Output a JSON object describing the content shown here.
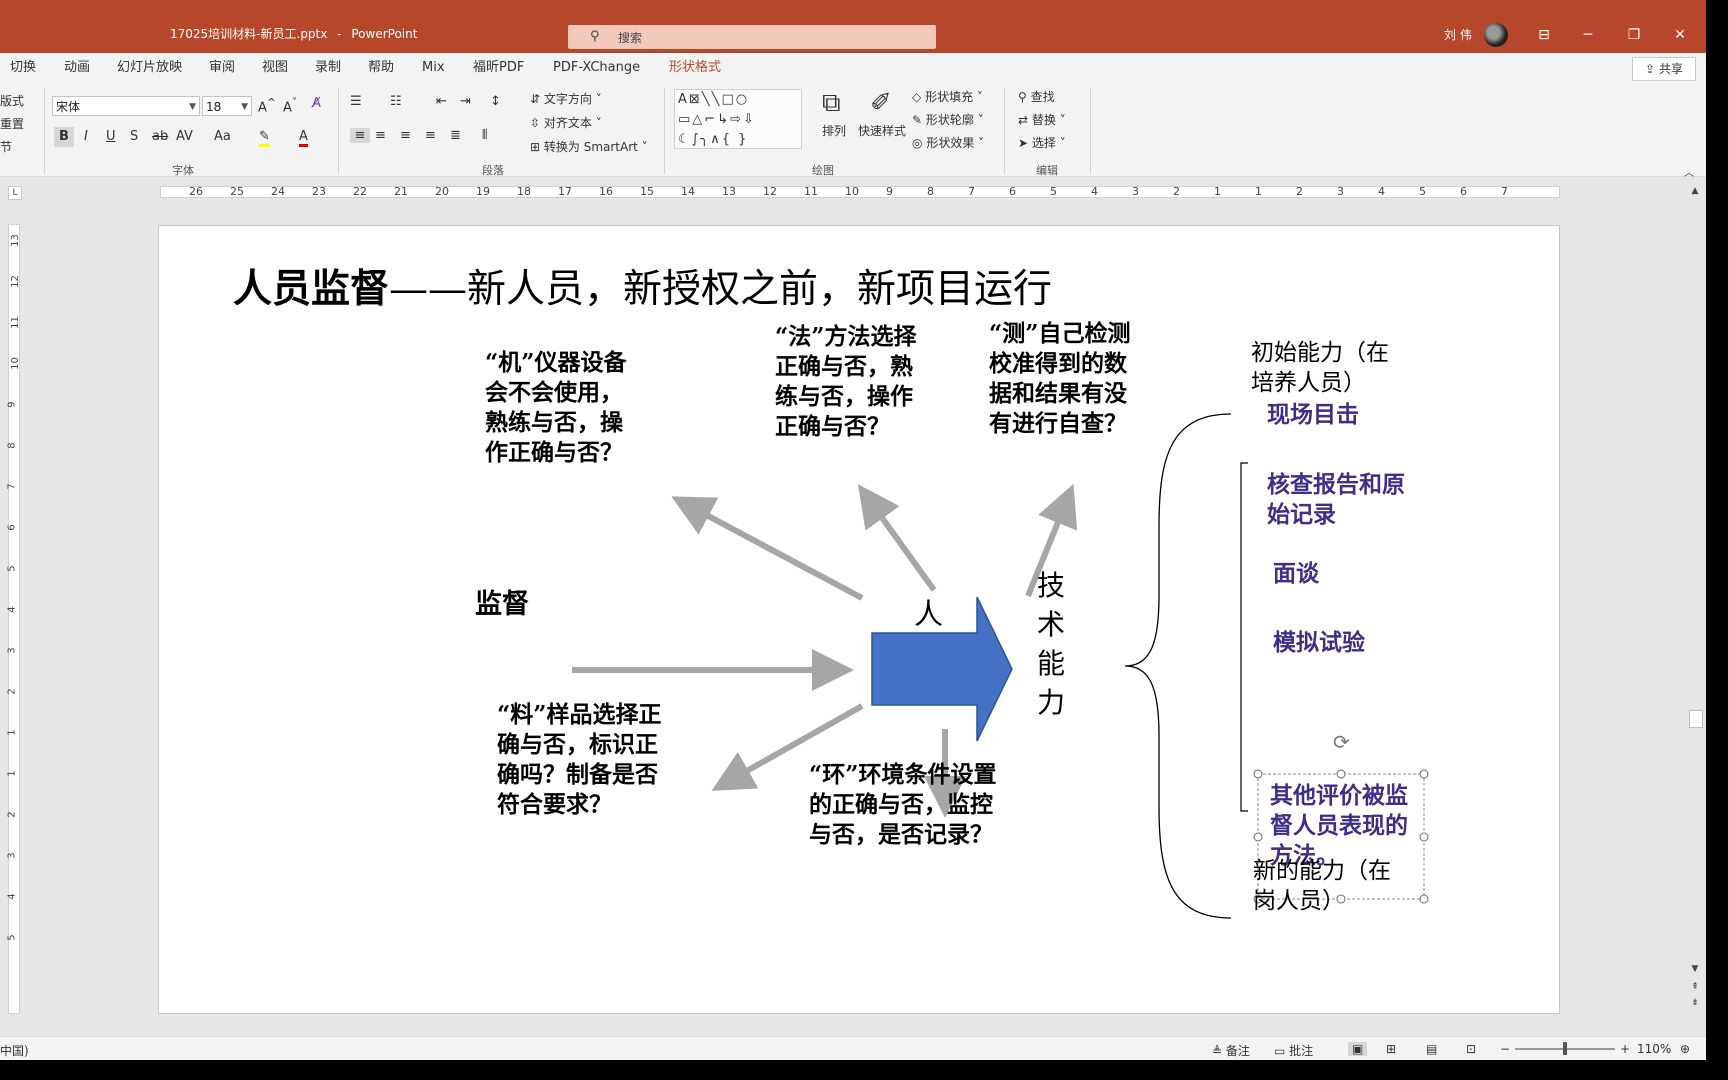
{
  "window": {
    "file_title": "17025培训材料-新员工.pptx",
    "separator": "-",
    "app_name": "PowerPoint",
    "search_placeholder": "搜索",
    "user_name": "刘 伟"
  },
  "tabs": [
    "切换",
    "动画",
    "幻灯片放映",
    "审阅",
    "视图",
    "录制",
    "帮助",
    "Mix",
    "福昕PDF",
    "PDF-XChange",
    "形状格式"
  ],
  "share_label": "共享",
  "ribbon": {
    "left_partial": [
      "版式",
      "重置",
      "节"
    ],
    "font_name": "宋体",
    "font_size": "18",
    "font_group_label": "字体",
    "paragraph_group_label": "段落",
    "drawing_group_label": "绘图",
    "editing_group_label": "编辑",
    "text_direction": "文字方向",
    "align_text": "对齐文本",
    "convert_smartart": "转换为 SmartArt",
    "arrange": "排列",
    "quick_styles": "快速样式",
    "shape_fill": "形状填充",
    "shape_outline": "形状轮廓",
    "shape_effects": "形状效果",
    "find": "查找",
    "replace": "替换",
    "select": "选择"
  },
  "ruler_numbers": [
    "26",
    "25",
    "24",
    "23",
    "22",
    "21",
    "20",
    "19",
    "18",
    "17",
    "16",
    "15",
    "14",
    "13",
    "12",
    "11",
    "10",
    "9",
    "8",
    "7",
    "6",
    "5",
    "4",
    "3",
    "2",
    "1",
    "1",
    "2",
    "3",
    "4",
    "5",
    "6",
    "7"
  ],
  "vruler_numbers": [
    "13",
    "12",
    "11",
    "10",
    "9",
    "8",
    "7",
    "6",
    "5",
    "4",
    "3",
    "2",
    "1",
    "1",
    "2",
    "3",
    "4",
    "5"
  ],
  "slide": {
    "title_bold": "人员监督",
    "title_rest": "——新人员，新授权之前，新项目运行",
    "ji": "“机”仪器设备会不会使用，熟练与否，操作正确与否？",
    "fa": "“法”方法选择正确与否，熟练与否，操作正确与否？",
    "ce": "“测”自己检测校准得到的数据和结果有没有进行自查？",
    "liao": "“料”样品选择正确与否，标识正确吗？制备是否符合要求？",
    "huan": "“环”环境条件设置的正确与否，监控与否，是否记录？",
    "jiandu": "监督",
    "ren": "人",
    "jishu": "技术能力",
    "initial": "初始能力（在培养人员）",
    "methods": [
      "现场目击",
      "核查报告和原始记录",
      "面谈",
      "模拟试验",
      "其他评价被监督人员表现的方法。"
    ],
    "new_ability": "新的能力（在岗人员）"
  },
  "statusbar": {
    "lang": "中国)",
    "notes": "备注",
    "comments": "批注",
    "zoom": "110%"
  },
  "colors": {
    "titlebar": "#b7472a",
    "arrow_fill": "#4472c4",
    "grey_arrow": "#a6a6a6",
    "purple_text": "#3a2f8a"
  }
}
